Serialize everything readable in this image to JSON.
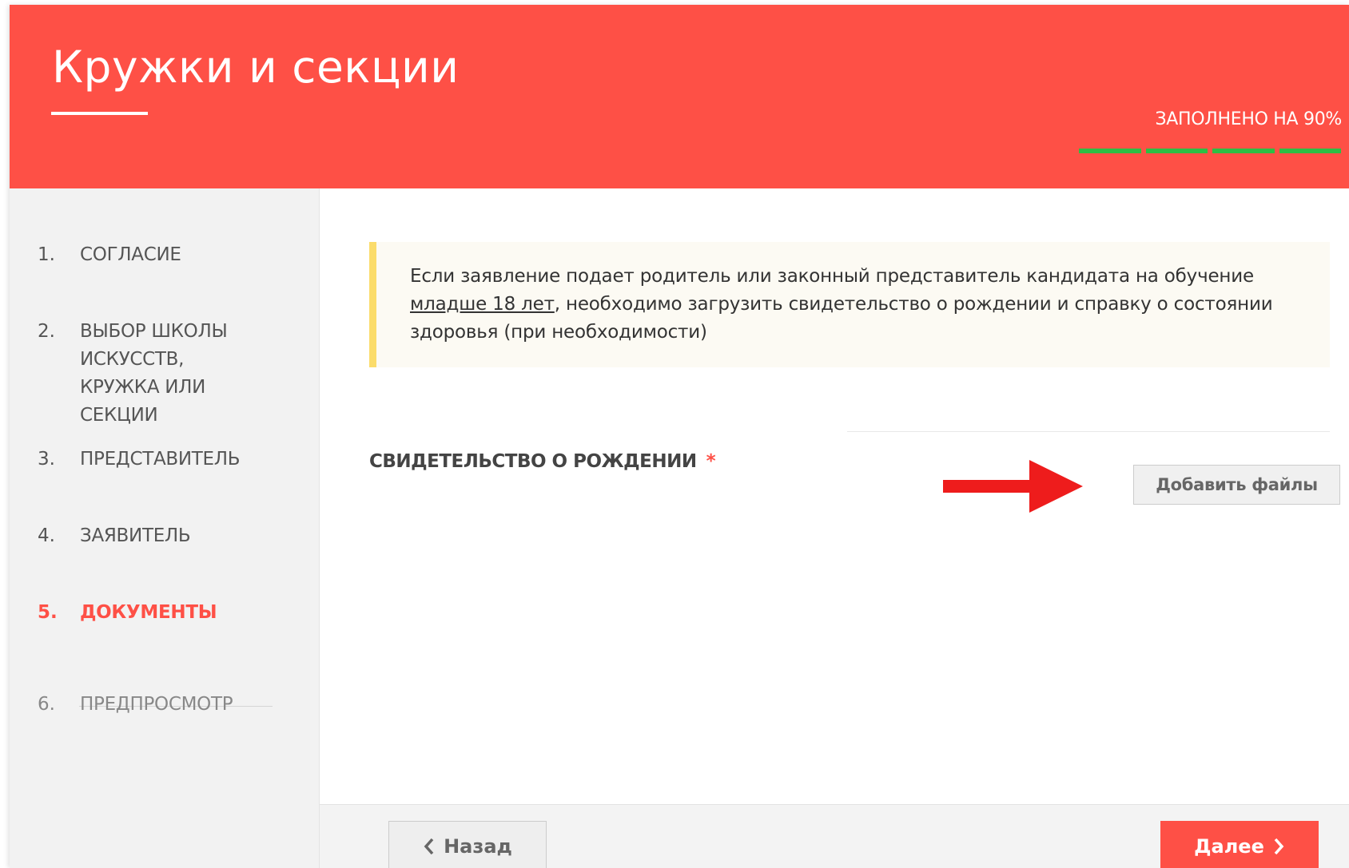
{
  "header": {
    "title": "Кружки и секции",
    "progress_text": "ЗАПОЛНЕНО НА 90%",
    "progress_segments": 4,
    "accent_color": "#fe5046",
    "progress_color": "#2dbe44"
  },
  "steps": [
    {
      "num": "1.",
      "label": "СОГЛАСИЕ",
      "state": "done"
    },
    {
      "num": "2.",
      "label": "ВЫБОР ШКОЛЫ ИСКУССТВ, КРУЖКА ИЛИ СЕКЦИИ",
      "state": "done"
    },
    {
      "num": "3.",
      "label": "ПРЕДСТАВИТЕЛЬ",
      "state": "done"
    },
    {
      "num": "4.",
      "label": "ЗАЯВИТЕЛЬ",
      "state": "done"
    },
    {
      "num": "5.",
      "label": "ДОКУМЕНТЫ",
      "state": "active"
    },
    {
      "num": "6.",
      "label": "ПРЕДПРОСМОТР",
      "state": "pending"
    }
  ],
  "notice": {
    "text_before": "Если заявление подает родитель или законный представитель кандидата на обучение ",
    "text_underlined": "младше 18 лет",
    "text_after": ", необходимо загрузить свидетельство о рождении и справку о состоянии здоровья (при необходимости)"
  },
  "document_field": {
    "label": "СВИДЕТЕЛЬСТВО О РОЖДЕНИИ",
    "required_mark": "*",
    "add_button": "Добавить файлы"
  },
  "footer": {
    "back_label": "Назад",
    "next_label": "Далее"
  }
}
